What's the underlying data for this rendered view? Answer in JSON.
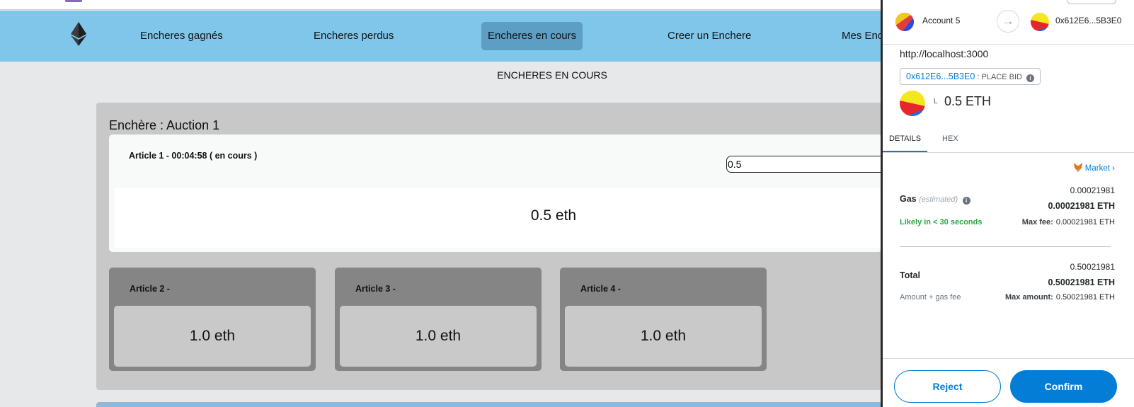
{
  "nav": {
    "items": [
      {
        "label": "Encheres gagnés"
      },
      {
        "label": "Encheres perdus"
      },
      {
        "label": "Encheres en cours"
      },
      {
        "label": "Creer un Enchere"
      },
      {
        "label": "Mes Encheres"
      }
    ],
    "active": "Encheres en cours"
  },
  "page": {
    "title": "ENCHERES EN COURS"
  },
  "auction": {
    "title": "Enchère : Auction 1",
    "main_article": {
      "label": "Article 1 - 00:04:58 ( en cours )",
      "bid_value": "0.5",
      "price": "0.5 eth"
    },
    "articles": [
      {
        "label": "Article 2 -",
        "price": "1.0 eth"
      },
      {
        "label": "Article 3 -",
        "price": "1.0 eth"
      },
      {
        "label": "Article 4 -",
        "price": "1.0 eth"
      }
    ]
  },
  "metamask": {
    "from_account": "Account 5",
    "to_address": "0x612E6...5B3E0",
    "origin": "http://localhost:3000",
    "contract_address": "0x612E6...5B3E0",
    "method_separator": ":",
    "method": "PLACE BID",
    "value_prefix": "L",
    "value": "0.5 ETH",
    "tabs": [
      "DETAILS",
      "HEX"
    ],
    "market_label": "Market",
    "gas": {
      "label": "Gas",
      "estimated": "(estimated)",
      "value": "0.00021981",
      "value_eth": "0.00021981 ETH",
      "likely": "Likely in < 30 seconds",
      "max_fee_label": "Max fee:",
      "max_fee": "0.00021981 ETH"
    },
    "total": {
      "label": "Total",
      "value": "0.50021981",
      "value_eth": "0.50021981 ETH",
      "sub_label": "Amount + gas fee",
      "max_amount_label": "Max amount:",
      "max_amount": "0.50021981 ETH"
    },
    "reject_label": "Reject",
    "confirm_label": "Confirm"
  },
  "colors": {
    "navbar": "#7fc6ea",
    "nav_active": "#5d9fc4",
    "metamask_blue": "#037dd6",
    "likely_green": "#28a745"
  }
}
